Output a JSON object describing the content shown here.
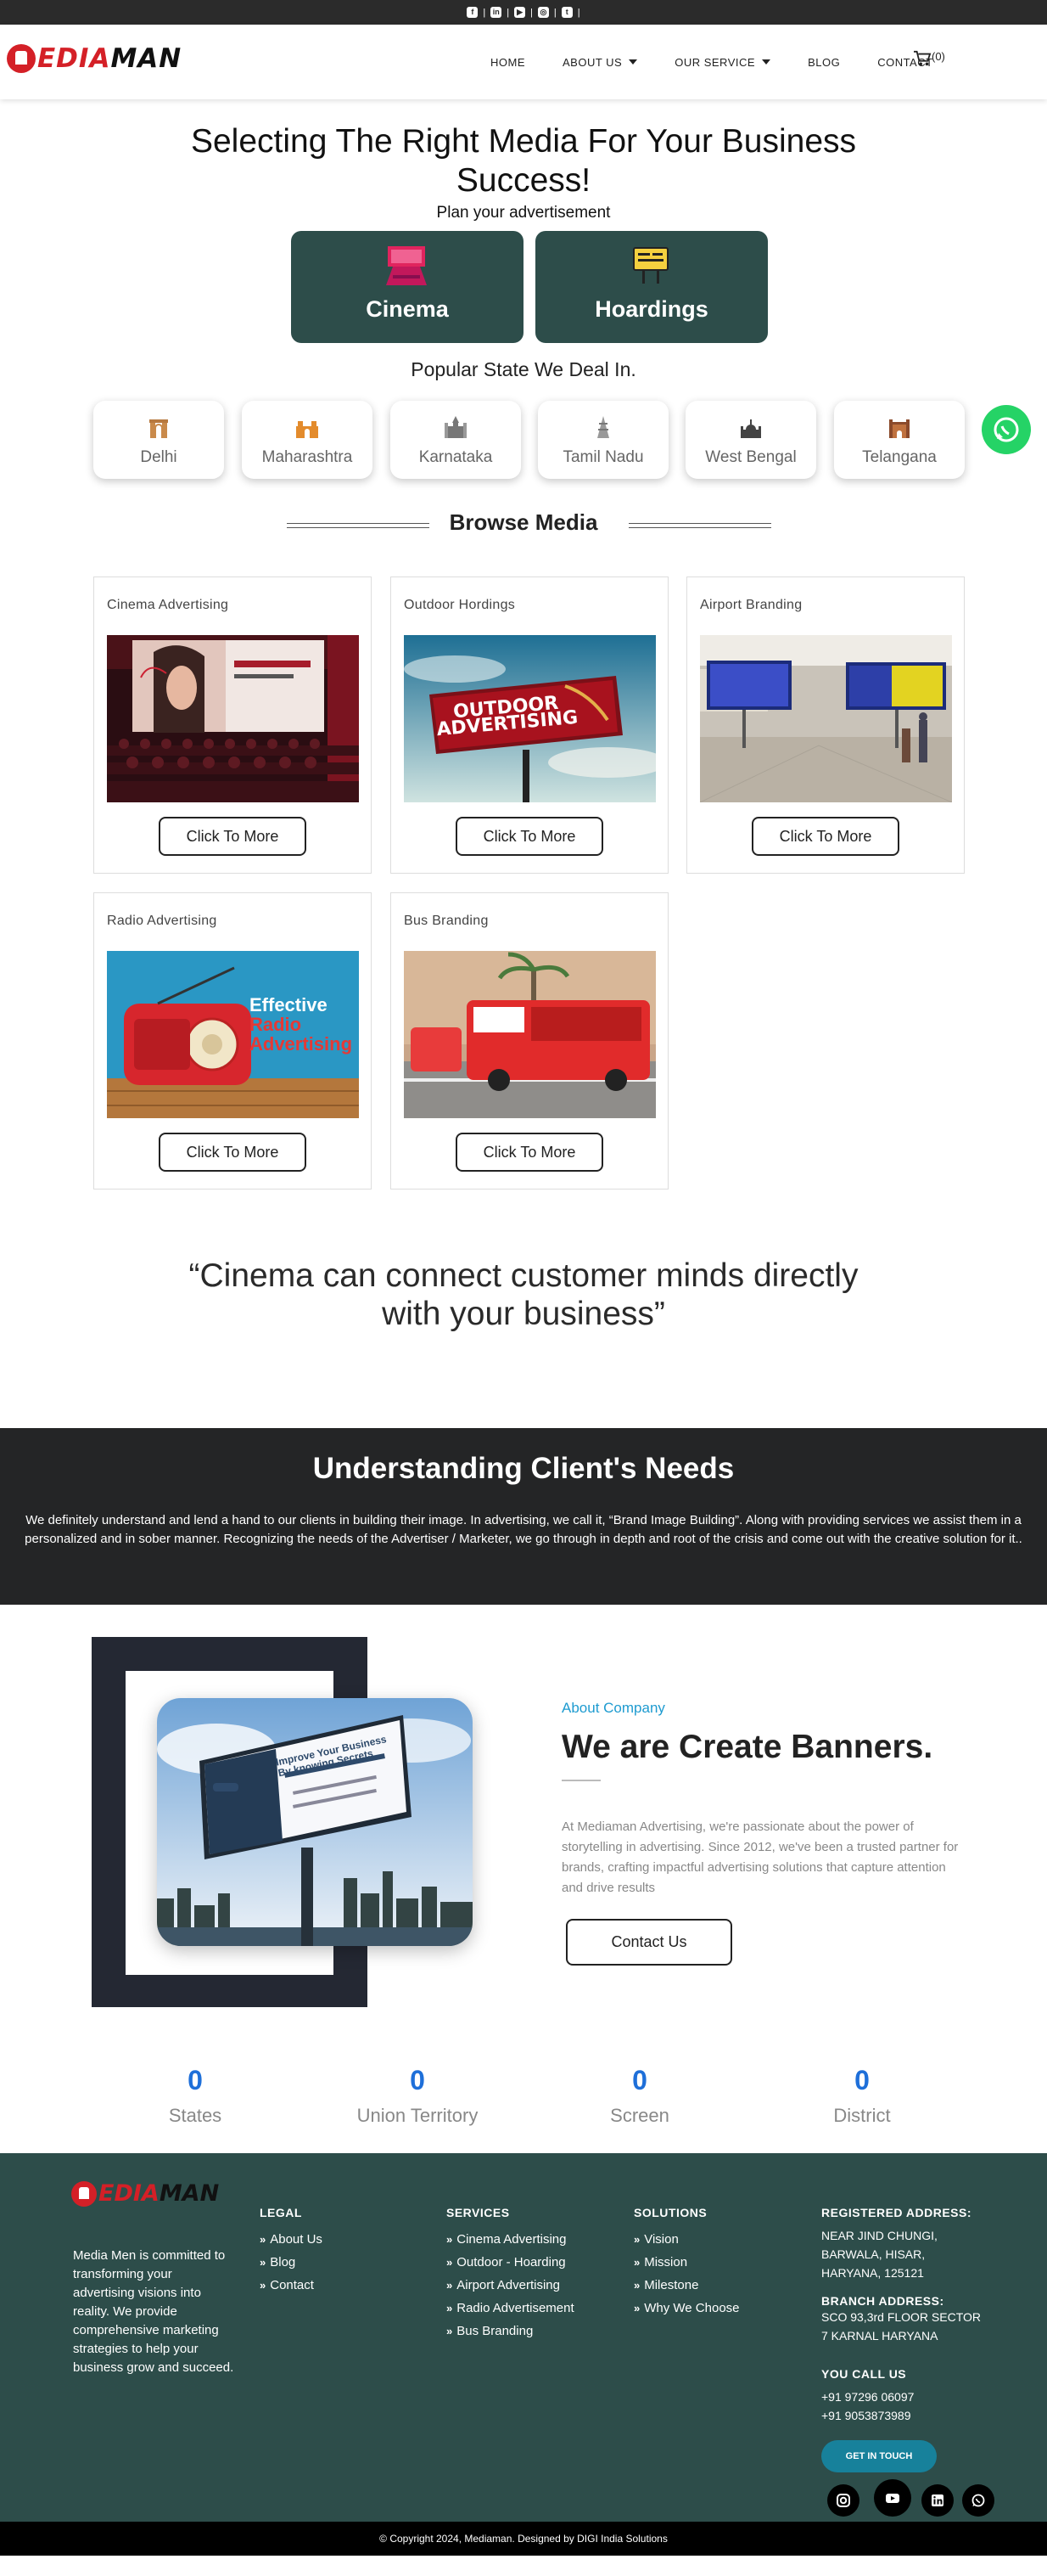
{
  "topbar": {
    "icons": [
      "facebook-icon",
      "linkedin-icon",
      "youtube-icon",
      "instagram-icon",
      "twitter-icon"
    ]
  },
  "header": {
    "logo": {
      "first": "EDIA",
      "second": "MAN"
    },
    "nav": [
      {
        "label": "HOME"
      },
      {
        "label": "ABOUT US"
      },
      {
        "label": "OUR SERVICE"
      },
      {
        "label": "BLOG"
      },
      {
        "label": "CONTACT"
      }
    ],
    "cart_count": "(0)"
  },
  "hero": {
    "title": "Selecting The Right Media For Your Business Success!",
    "subtitle": "Plan your advertisement",
    "buttons": [
      {
        "label": "Cinema"
      },
      {
        "label": "Hoardings"
      }
    ]
  },
  "states": {
    "heading": "Popular State We Deal In.",
    "items": [
      {
        "label": "Delhi"
      },
      {
        "label": "Maharashtra"
      },
      {
        "label": "Karnataka"
      },
      {
        "label": "Tamil Nadu"
      },
      {
        "label": "West Bengal"
      },
      {
        "label": "Telangana"
      }
    ]
  },
  "browse": {
    "heading": "Browse Media",
    "cards": [
      {
        "title": "Cinema Advertising",
        "button": "Click To More"
      },
      {
        "title": "Outdoor Hordings",
        "button": "Click To More",
        "image_text": "OUTDOOR ADVERTISING"
      },
      {
        "title": "Airport Branding",
        "button": "Click To More"
      },
      {
        "title": "Radio Advertising",
        "button": "Click To More",
        "image_text": [
          "Effective",
          "Radio",
          "Advertising"
        ]
      },
      {
        "title": "Bus Branding",
        "button": "Click To More"
      }
    ]
  },
  "quote": "“Cinema can connect customer minds directly with your business”",
  "needs": {
    "title": "Understanding Client's Needs",
    "body": "We definitely understand and lend a hand to our clients in building their image. In advertising, we call it, “Brand Image Building”. Along with providing services we assist them in a personalized and in sober manner. Recognizing the needs of the Advertiser / Marketer, we go through in depth and root of the crisis and come out with the creative solution for it.."
  },
  "about": {
    "label": "About Company",
    "title": "We are Create Banners.",
    "text": "At Mediaman Advertising, we're passionate about the power of storytelling in advertising. Since 2012, we've been a trusted partner for brands, crafting impactful advertising solutions that capture attention and drive results",
    "button": "Contact Us",
    "billboard_text": "Improve Your Business By knowing Secrets"
  },
  "stats": [
    {
      "value": "0",
      "label": "States"
    },
    {
      "value": "0",
      "label": "Union Territory"
    },
    {
      "value": "0",
      "label": "Screen"
    },
    {
      "value": "0",
      "label": "District"
    }
  ],
  "footer": {
    "description": "Media Men is committed to transforming your advertising visions into reality. We provide comprehensive marketing strategies to help your business grow and succeed.",
    "legal": {
      "heading": "LEGAL",
      "items": [
        "About Us",
        "Blog",
        "Contact"
      ]
    },
    "services": {
      "heading": "SERVICES",
      "items": [
        "Cinema Advertising",
        "Outdoor - Hoarding",
        "Airport Advertising",
        "Radio Advertisement",
        "Bus Branding"
      ]
    },
    "solutions": {
      "heading": "SOLUTIONS",
      "items": [
        "Vision",
        "Mission",
        "Milestone",
        "Why We Choose"
      ]
    },
    "registered": {
      "heading": "REGISTERED ADDRESS:",
      "lines": [
        "NEAR JIND CHUNGI,",
        "BARWALA, HISAR,",
        "HARYANA, 125121"
      ]
    },
    "branch": {
      "heading": "BRANCH ADDRESS:",
      "lines": [
        "SCO 93,3rd FLOOR SECTOR",
        "7 KARNAL HARYANA"
      ]
    },
    "call": {
      "heading": "YOU CALL US",
      "lines": [
        "+91 97296 06097",
        "+91 9053873989"
      ]
    },
    "get_in_touch": "GET IN TOUCH",
    "social": [
      "instagram-icon",
      "youtube-icon",
      "linkedin-icon",
      "whatsapp-icon"
    ]
  },
  "copyright": "© Copyright 2024, Mediaman. Designed by DIGI India Solutions",
  "colors": {
    "brand_red": "#d42027",
    "teal": "#2d4d4a",
    "dark": "#242526",
    "accent_blue": "#1e6fd9",
    "whatsapp": "#25d366"
  }
}
